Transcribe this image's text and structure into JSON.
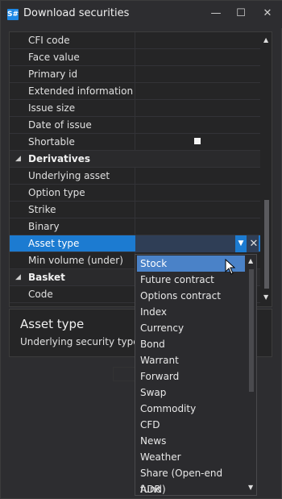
{
  "window": {
    "title": "Download securities",
    "logo_text": "S#"
  },
  "properties": {
    "rows": [
      {
        "label": "CFI code",
        "kind": "prop"
      },
      {
        "label": "Face value",
        "kind": "prop"
      },
      {
        "label": "Primary id",
        "kind": "prop"
      },
      {
        "label": "Extended information",
        "kind": "prop"
      },
      {
        "label": "Issue size",
        "kind": "prop"
      },
      {
        "label": "Date of issue",
        "kind": "prop"
      },
      {
        "label": "Shortable",
        "kind": "prop",
        "checkbox_checked": false
      },
      {
        "label": "Derivatives",
        "kind": "category"
      },
      {
        "label": "Underlying asset",
        "kind": "prop"
      },
      {
        "label": "Option type",
        "kind": "prop"
      },
      {
        "label": "Strike",
        "kind": "prop"
      },
      {
        "label": "Binary",
        "kind": "prop"
      },
      {
        "label": "Asset type",
        "kind": "selected"
      },
      {
        "label": "Min volume (under)",
        "kind": "prop"
      },
      {
        "label": "Basket",
        "kind": "category"
      },
      {
        "label": "Code",
        "kind": "prop"
      }
    ]
  },
  "description": {
    "title": "Asset type",
    "text": "Underlying security type."
  },
  "dropdown": {
    "selected": "Stock",
    "options": [
      "Stock",
      "Future contract",
      "Options contract",
      "Index",
      "Currency",
      "Bond",
      "Warrant",
      "Forward",
      "Swap",
      "Commodity",
      "CFD",
      "News",
      "Weather",
      "Share (Open-end fund)",
      "ADR"
    ]
  },
  "colors": {
    "accent": "#1c7bd1",
    "selected_item": "#4a82c8",
    "background": "#2d2d30"
  },
  "icons": {
    "minimize": "minimize-icon",
    "maximize": "maximize-icon",
    "close": "close-icon",
    "dropdown": "chevron-down-icon",
    "clear": "clear-icon"
  }
}
